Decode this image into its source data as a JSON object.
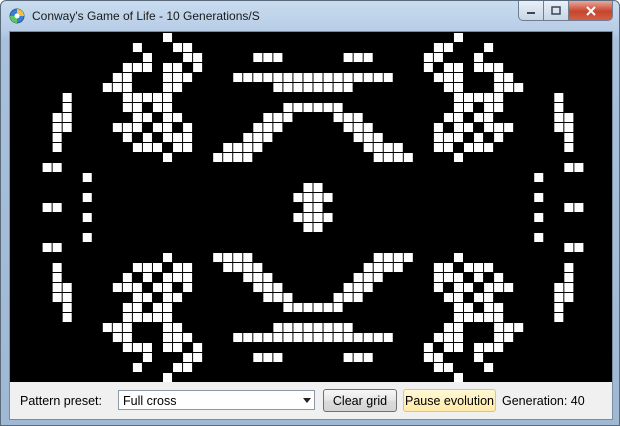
{
  "window": {
    "title": "Conway's Game of Life - 10 Generations/S"
  },
  "toolbar": {
    "preset_label": "Pattern preset:",
    "preset_value": "Full cross",
    "clear_label": "Clear grid",
    "pause_label": "Pause evolution",
    "generation_text": "Generation: 40"
  },
  "colors": {
    "board": "#000000",
    "cell": "#ffffff",
    "pause_highlight": "#ffeaa8"
  },
  "icons": [
    "app-icon",
    "minimize-icon",
    "maximize-icon",
    "close-icon",
    "chevron-down-icon"
  ],
  "board": {
    "cols": 60,
    "rows": 35,
    "cells": [
      [
        15,
        0
      ],
      [
        12,
        1
      ],
      [
        16,
        1
      ],
      [
        17,
        1
      ],
      [
        13,
        2
      ],
      [
        17,
        2
      ],
      [
        18,
        2
      ],
      [
        11,
        3
      ],
      [
        12,
        3
      ],
      [
        13,
        3
      ],
      [
        15,
        3
      ],
      [
        16,
        3
      ],
      [
        18,
        3
      ],
      [
        10,
        4
      ],
      [
        11,
        4
      ],
      [
        15,
        4
      ],
      [
        16,
        4
      ],
      [
        17,
        4
      ],
      [
        9,
        5
      ],
      [
        10,
        5
      ],
      [
        11,
        5
      ],
      [
        15,
        5
      ],
      [
        16,
        5
      ],
      [
        11,
        6
      ],
      [
        12,
        6
      ],
      [
        13,
        6
      ],
      [
        14,
        6
      ],
      [
        15,
        6
      ],
      [
        11,
        7
      ],
      [
        12,
        7
      ],
      [
        14,
        7
      ],
      [
        15,
        7
      ],
      [
        12,
        8
      ],
      [
        13,
        8
      ],
      [
        15,
        8
      ],
      [
        16,
        8
      ],
      [
        10,
        9
      ],
      [
        11,
        9
      ],
      [
        12,
        9
      ],
      [
        14,
        9
      ],
      [
        15,
        9
      ],
      [
        17,
        9
      ],
      [
        11,
        10
      ],
      [
        13,
        10
      ],
      [
        15,
        10
      ],
      [
        16,
        10
      ],
      [
        17,
        10
      ],
      [
        12,
        11
      ],
      [
        13,
        11
      ],
      [
        14,
        11
      ],
      [
        16,
        11
      ],
      [
        17,
        11
      ],
      [
        15,
        12
      ],
      [
        5,
        6
      ],
      [
        5,
        7
      ],
      [
        4,
        8
      ],
      [
        5,
        8
      ],
      [
        4,
        9
      ],
      [
        5,
        9
      ],
      [
        4,
        10
      ],
      [
        4,
        11
      ],
      [
        3,
        13
      ],
      [
        4,
        13
      ],
      [
        7,
        14
      ],
      [
        7,
        16
      ],
      [
        3,
        17
      ],
      [
        4,
        17
      ],
      [
        24,
        2
      ],
      [
        25,
        2
      ],
      [
        33,
        2
      ],
      [
        34,
        2
      ],
      [
        23,
        4
      ],
      [
        25,
        4
      ],
      [
        26,
        4
      ],
      [
        28,
        4
      ],
      [
        29,
        4
      ],
      [
        31,
        4
      ],
      [
        32,
        4
      ],
      [
        34,
        4
      ],
      [
        35,
        4
      ],
      [
        37,
        4
      ],
      [
        26,
        5
      ],
      [
        28,
        5
      ],
      [
        29,
        5
      ],
      [
        31,
        5
      ],
      [
        32,
        5
      ],
      [
        28,
        7
      ],
      [
        29,
        7
      ],
      [
        31,
        7
      ],
      [
        32,
        7
      ],
      [
        26,
        8
      ],
      [
        27,
        8
      ],
      [
        33,
        8
      ],
      [
        34,
        8
      ],
      [
        25,
        9
      ],
      [
        26,
        9
      ],
      [
        34,
        9
      ],
      [
        35,
        9
      ],
      [
        24,
        10
      ],
      [
        25,
        10
      ],
      [
        35,
        10
      ],
      [
        36,
        10
      ],
      [
        22,
        11
      ],
      [
        23,
        11
      ],
      [
        24,
        11
      ],
      [
        36,
        11
      ],
      [
        37,
        11
      ],
      [
        38,
        11
      ],
      [
        21,
        12
      ],
      [
        22,
        12
      ],
      [
        23,
        12
      ],
      [
        37,
        12
      ],
      [
        38,
        12
      ],
      [
        39,
        12
      ],
      [
        30,
        15
      ],
      [
        29,
        16
      ],
      [
        31,
        16
      ],
      [
        30,
        17
      ]
    ]
  }
}
